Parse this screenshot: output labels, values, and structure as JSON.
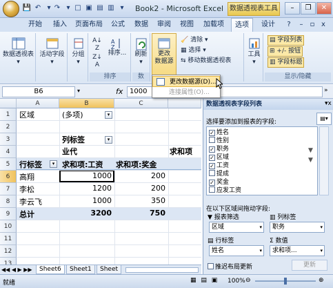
{
  "window": {
    "title": "Book2 - Microsoft Excel",
    "context_tab_title": "数据透视表工具"
  },
  "tabs": [
    {
      "label": "开始"
    },
    {
      "label": "插入"
    },
    {
      "label": "页面布局"
    },
    {
      "label": "公式"
    },
    {
      "label": "数据"
    },
    {
      "label": "审阅"
    },
    {
      "label": "视图"
    },
    {
      "label": "加载项"
    },
    {
      "label": "选项",
      "active": true
    },
    {
      "label": "设计"
    }
  ],
  "ribbon": {
    "pivot_table_label": "数据透视表",
    "active_field_label": "活动字段",
    "group_label": "分组",
    "sort_label": "排序...",
    "sort_group_label": "排序",
    "refresh_label": "刷新",
    "change_source_label": "更改\n数据源",
    "clear_label": "清除",
    "select_label": "选择",
    "move_label": "移动数据透视表",
    "tools_label": "工具",
    "field_list_label": "字段列表",
    "buttons_label": "+/- 按钮",
    "headers_label": "字段标题",
    "show_hide_group_label": "显示/隐藏",
    "data_group_label": "数"
  },
  "popup": {
    "item1": "更改数据源(D)...",
    "item2": "连接属性(O)..."
  },
  "formula_bar": {
    "name_box": "B6",
    "fx": "fx",
    "value": "1000"
  },
  "sheet": {
    "columns": [
      "A",
      "B",
      "C"
    ],
    "rows": [
      "1",
      "2",
      "3",
      "4",
      "5",
      "6",
      "7",
      "8",
      "9",
      "10",
      "11",
      "12",
      "13"
    ],
    "r1a": "区域",
    "r1b": "(多项)",
    "r3b": "列标签",
    "r4b": "业代",
    "r4d": "求和项",
    "r5a": "行标签",
    "r5b": "求和项:工资",
    "r5c": "求和项:奖金",
    "data_rows": [
      {
        "name": "高翔",
        "salary": "1000",
        "bonus": "200"
      },
      {
        "name": "李松",
        "salary": "1200",
        "bonus": "200"
      },
      {
        "name": "李云飞",
        "salary": "1000",
        "bonus": "350"
      }
    ],
    "total_label": "总计",
    "total_salary": "3200",
    "total_bonus": "750",
    "tabs": [
      "Sheet6",
      "Sheet1",
      "Sheet"
    ]
  },
  "status": {
    "ready": "就绪",
    "zoom": "100%"
  },
  "pane": {
    "title": "数据透视表字段列表",
    "choose_label": "选择要添加到报表的字段:",
    "fields": [
      {
        "label": "姓名",
        "checked": true
      },
      {
        "label": "性别",
        "checked": false
      },
      {
        "label": "职务",
        "checked": true
      },
      {
        "label": "区域",
        "checked": true
      },
      {
        "label": "工资",
        "checked": true
      },
      {
        "label": "提成",
        "checked": false
      },
      {
        "label": "奖金",
        "checked": true
      },
      {
        "label": "应发工资",
        "checked": false
      }
    ],
    "drag_label": "在以下区域间拖动字段:",
    "report_filter_label": "报表筛选",
    "column_labels_label": "列标签",
    "row_labels_label": "行标签",
    "values_label": "数值",
    "filter_value": "区域",
    "column_value": "职务",
    "row_value": "姓名",
    "values_value": "求和项...",
    "defer_label": "推迟布局更新",
    "update_label": "更新"
  }
}
